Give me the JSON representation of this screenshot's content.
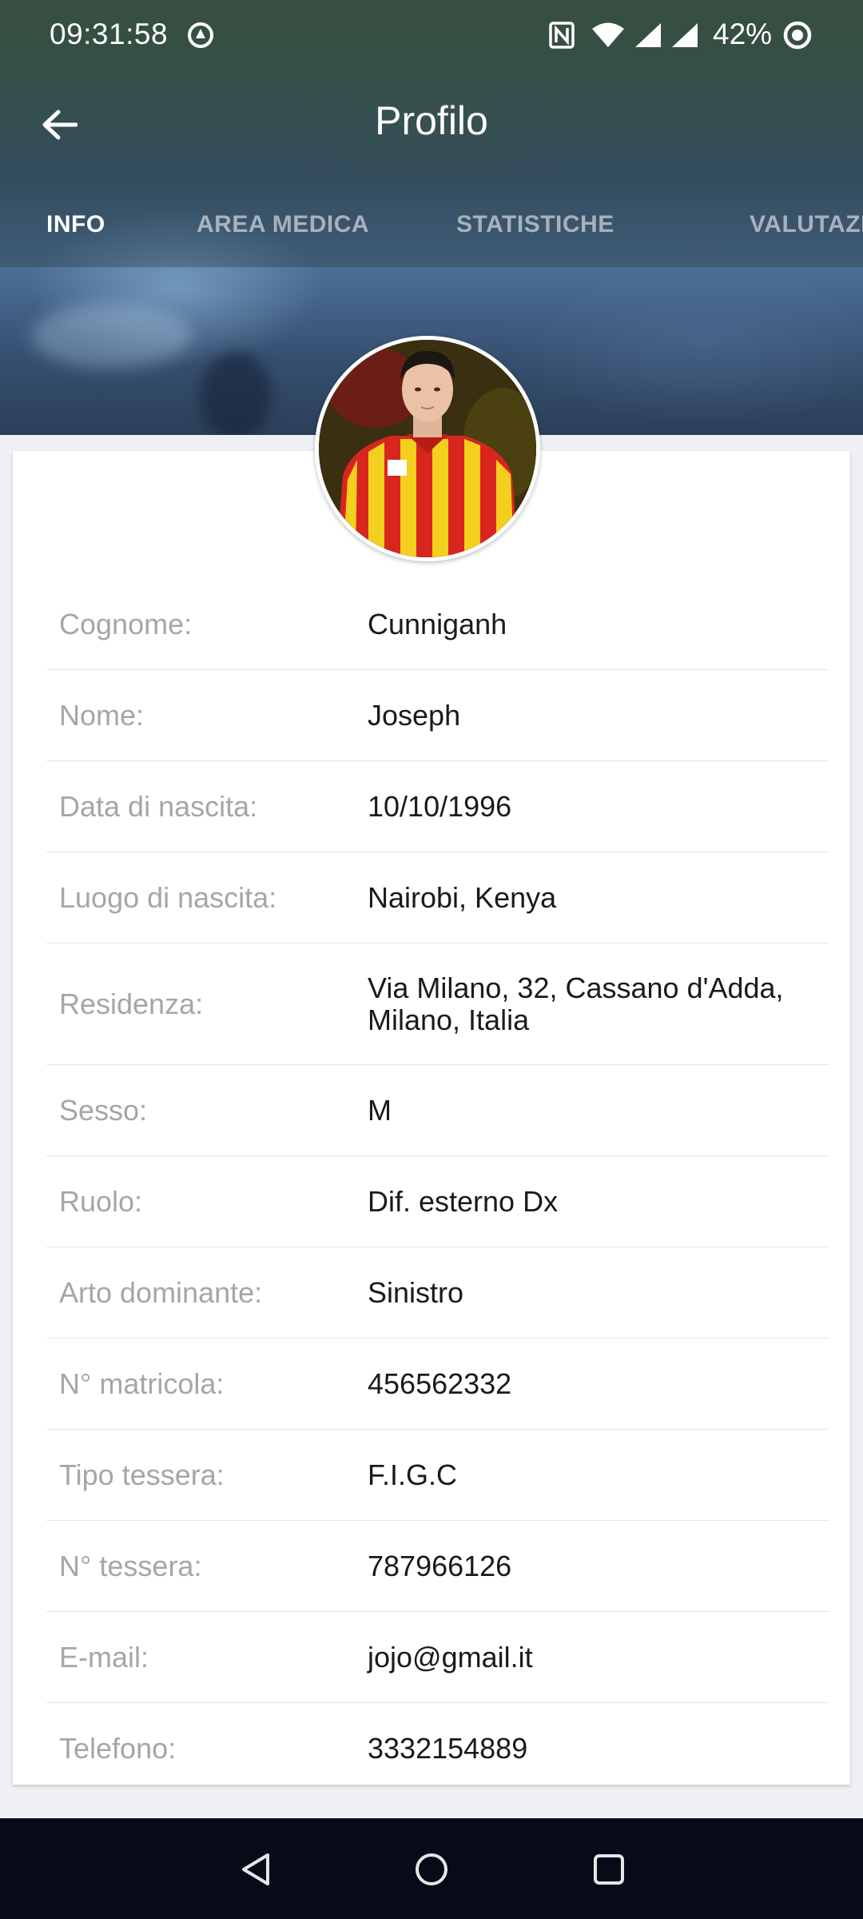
{
  "status_bar": {
    "time": "09:31:58",
    "battery": "42%",
    "icons": [
      "sync-icon",
      "nfc-icon",
      "wifi-icon",
      "signal-icon",
      "signal-icon",
      "battery-icon"
    ]
  },
  "app_bar": {
    "title": "Profilo",
    "back_icon": "arrow-left-icon"
  },
  "tabs": [
    {
      "label": "INFO",
      "active": true
    },
    {
      "label": "AREA MEDICA",
      "active": false
    },
    {
      "label": "STATISTICHE",
      "active": false
    },
    {
      "label": "VALUTAZI",
      "active": false
    }
  ],
  "profile": {
    "fields": [
      {
        "label": "Cognome:",
        "value": "Cunniganh"
      },
      {
        "label": "Nome:",
        "value": "Joseph"
      },
      {
        "label": "Data di nascita:",
        "value": "10/10/1996"
      },
      {
        "label": "Luogo di nascita:",
        "value": "Nairobi, Kenya"
      },
      {
        "label": "Residenza:",
        "value": "Via Milano, 32, Cassano d'Adda, Milano, Italia"
      },
      {
        "label": "Sesso:",
        "value": "M"
      },
      {
        "label": "Ruolo:",
        "value": "Dif. esterno Dx"
      },
      {
        "label": "Arto dominante:",
        "value": "Sinistro"
      },
      {
        "label": "N° matricola:",
        "value": "456562332"
      },
      {
        "label": "Tipo tessera:",
        "value": "F.I.G.C"
      },
      {
        "label": "N° tessera:",
        "value": "787966126"
      },
      {
        "label": "E-mail:",
        "value": "jojo@gmail.it"
      },
      {
        "label": "Telefono:",
        "value": "3332154889"
      }
    ]
  },
  "nav_bar": {
    "buttons": [
      "back-triangle-icon",
      "home-circle-icon",
      "recents-square-icon"
    ]
  },
  "colors": {
    "label_text": "#a6a6a6",
    "value_text": "#1a1a1a",
    "nav_bar": "#080a1a",
    "jersey_red": "#d8261f",
    "jersey_yellow": "#f3cf1e"
  }
}
